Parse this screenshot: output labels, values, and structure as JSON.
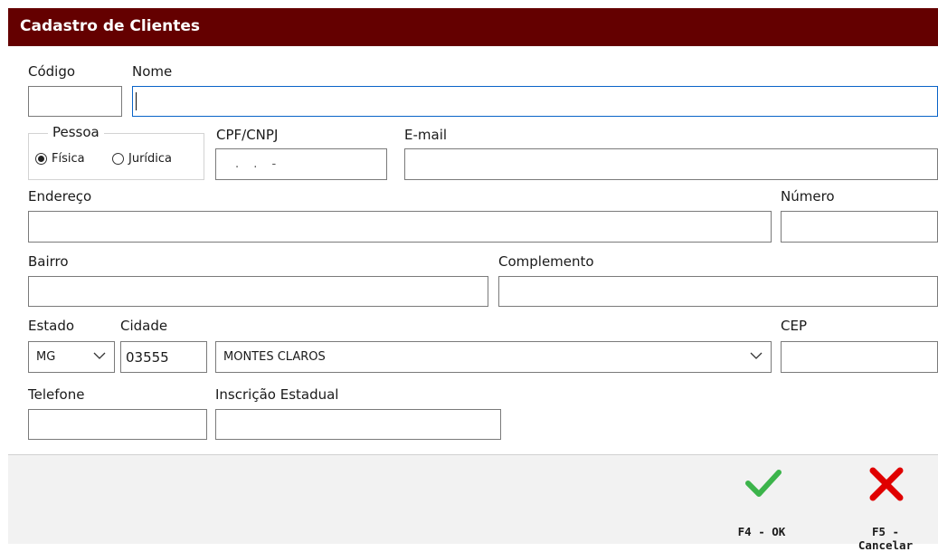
{
  "window": {
    "title": "Cadastro de Clientes"
  },
  "form": {
    "codigo": {
      "label": "Código",
      "value": ""
    },
    "nome": {
      "label": "Nome",
      "value": ""
    },
    "pessoa": {
      "legend": "Pessoa",
      "options": [
        "Física",
        "Jurídica"
      ],
      "selected": "Física"
    },
    "cpf_cnpj": {
      "label": "CPF/CNPJ",
      "mask": ". . -"
    },
    "email": {
      "label": "E-mail",
      "value": ""
    },
    "endereco": {
      "label": "Endereço",
      "value": ""
    },
    "numero": {
      "label": "Número",
      "value": ""
    },
    "bairro": {
      "label": "Bairro",
      "value": ""
    },
    "complemento": {
      "label": "Complemento",
      "value": ""
    },
    "estado": {
      "label": "Estado",
      "value": "MG"
    },
    "cidade": {
      "label": "Cidade",
      "code": "03555",
      "name": "MONTES CLAROS"
    },
    "cep": {
      "label": "CEP",
      "value": ""
    },
    "telefone": {
      "label": "Telefone",
      "value": ""
    },
    "inscricao_estadual": {
      "label": "Inscrição Estadual",
      "value": ""
    }
  },
  "footer": {
    "ok": {
      "label": "F4 - OK",
      "icon": "check-icon",
      "color": "#3cb44b"
    },
    "cancel": {
      "label": "F5 - Cancelar",
      "icon": "close-icon",
      "color": "#e00000"
    }
  },
  "colors": {
    "titlebar": "#640000",
    "focus": "#0a64c8"
  }
}
